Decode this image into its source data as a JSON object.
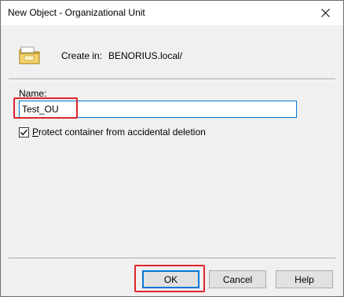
{
  "window": {
    "title": "New Object - Organizational Unit"
  },
  "header": {
    "icon": "ou-folder-icon",
    "create_in_label": "Create in:",
    "create_in_value": "BENORIUS.local/"
  },
  "form": {
    "name_label_mnemonic": "N",
    "name_label_rest": "ame:",
    "name_value": "Test_OU",
    "protect_checked": true,
    "protect_label_mnemonic": "P",
    "protect_label_rest": "rotect container from accidental deletion"
  },
  "buttons": {
    "ok": "OK",
    "cancel": "Cancel",
    "help": "Help"
  },
  "colors": {
    "highlight": "#e0242b",
    "focus": "#0078d7"
  }
}
